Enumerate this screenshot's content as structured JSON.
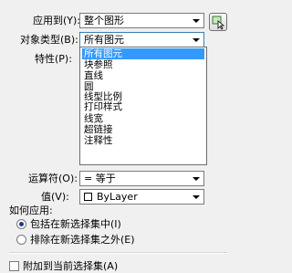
{
  "apply_to": {
    "label": "应用到(Y):",
    "value": "整个图形"
  },
  "object_type": {
    "label": "对象类型(B):",
    "value": "所有图元"
  },
  "properties": {
    "label": "特性(P):"
  },
  "object_type_options": [
    "所有图元",
    "块参照",
    "直线",
    "圆",
    "线型比例",
    "打印样式",
    "线宽",
    "超链接",
    "注释性"
  ],
  "operator": {
    "label": "运算符(O):",
    "value": "= 等于"
  },
  "value_field": {
    "label": "值(V):",
    "value": "ByLayer"
  },
  "how_to_apply": {
    "title": "如何应用:",
    "include": "包括在新选择集中(I)",
    "exclude": "排除在新选择集之外(E)"
  },
  "append": {
    "label": "附加到当前选择集(A)"
  }
}
